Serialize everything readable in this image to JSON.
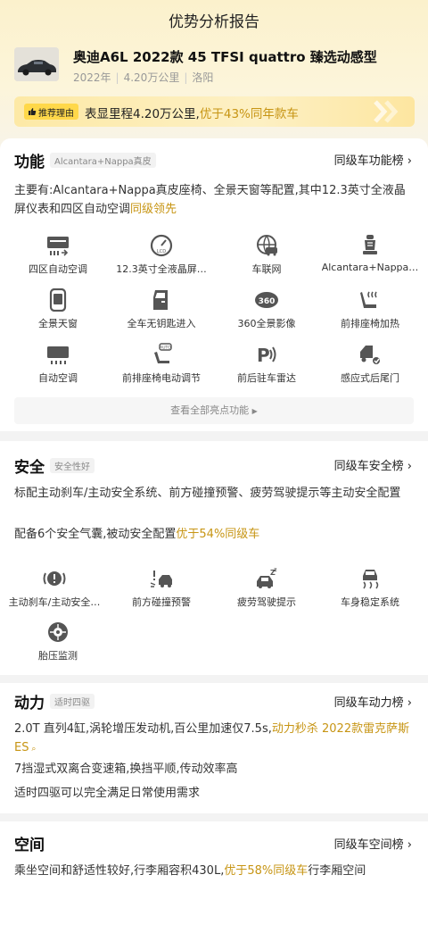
{
  "header": {
    "title": "优势分析报告"
  },
  "car": {
    "name": "奥迪A6L 2022款 45 TFSI quattro 臻选动感型",
    "year": "2022年",
    "mileage": "4.20万公里",
    "city": "洛阳"
  },
  "reason": {
    "tag": "推荐理由",
    "text": "表显里程4.20万公里,",
    "highlight": "优于43%同年款车"
  },
  "sections": {
    "function": {
      "title": "功能",
      "tag": "Alcantara+Nappa真皮",
      "rank": "同级车功能榜",
      "desc_prefix": "主要有:Alcantara+Nappa真皮座椅、全景天窗等配置,其中12.3英寸全液晶屏仪表和四区自动空调",
      "desc_highlight": "同级领先",
      "features": [
        {
          "label": "四区自动空调",
          "icon": "climate-icon"
        },
        {
          "label": "12.3英寸全液晶屏…",
          "icon": "lcd-gauge-icon"
        },
        {
          "label": "车联网",
          "icon": "connected-car-icon"
        },
        {
          "label": "Alcantara+Nappa…",
          "icon": "seat-icon"
        },
        {
          "label": "全景天窗",
          "icon": "sunroof-icon"
        },
        {
          "label": "全车无钥匙进入",
          "icon": "keyless-door-icon"
        },
        {
          "label": "360全景影像",
          "icon": "camera-360-icon"
        },
        {
          "label": "前排座椅加热",
          "icon": "seat-heating-icon"
        },
        {
          "label": "自动空调",
          "icon": "auto-ac-icon"
        },
        {
          "label": "前排座椅电动调节",
          "icon": "power-seat-icon"
        },
        {
          "label": "前后驻车雷达",
          "icon": "parking-radar-icon"
        },
        {
          "label": "感应式后尾门",
          "icon": "tailgate-icon"
        }
      ],
      "view_all": "查看全部亮点功能"
    },
    "safety": {
      "title": "安全",
      "tag": "安全性好",
      "rank": "同级车安全榜",
      "desc1": "标配主动刹车/主动安全系统、前方碰撞预警、疲劳驾驶提示等主动安全配置",
      "desc2_prefix": "配备6个安全气囊,被动安全配置",
      "desc2_highlight": "优于54%同级车",
      "features": [
        {
          "label": "主动刹车/主动安全…",
          "icon": "brake-warning-icon"
        },
        {
          "label": "前方碰撞预警",
          "icon": "collision-warning-icon"
        },
        {
          "label": "疲劳驾驶提示",
          "icon": "fatigue-icon"
        },
        {
          "label": "车身稳定系统",
          "icon": "stability-icon"
        },
        {
          "label": "胎压监测",
          "icon": "tire-pressure-icon"
        }
      ]
    },
    "power": {
      "title": "动力",
      "tag": "适时四驱",
      "rank": "同级车动力榜",
      "desc1_prefix": "2.0T 直列4缸,涡轮增压发动机,百公里加速仅7.5s,",
      "desc1_highlight": "动力秒杀 2022款雷克萨斯ES",
      "desc2": "7挡湿式双离合变速箱,换挡平顺,传动效率高",
      "desc3": "适时四驱可以完全满足日常使用需求"
    },
    "space": {
      "title": "空间",
      "rank": "同级车空间榜",
      "desc_prefix": "乘坐空间和舒适性较好,行李厢容积430L,",
      "desc_highlight": "优于58%同级车",
      "desc_suffix": "行李厢空间"
    }
  },
  "colors": {
    "accent": "#c79514",
    "tag_yellow": "#ffd84a",
    "hero_bg": "#fbf1cc"
  }
}
